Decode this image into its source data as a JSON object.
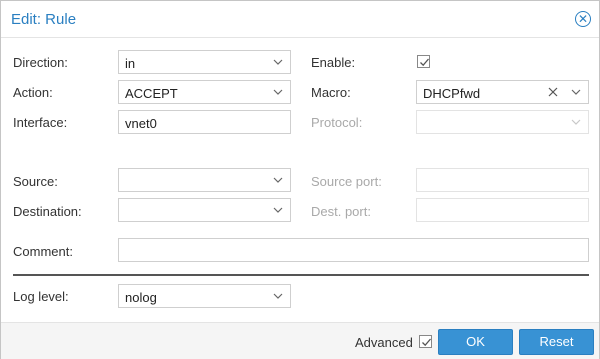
{
  "title": "Edit: Rule",
  "labels": {
    "direction": "Direction:",
    "action": "Action:",
    "interface": "Interface:",
    "enable": "Enable:",
    "macro": "Macro:",
    "protocol": "Protocol:",
    "source": "Source:",
    "destination": "Destination:",
    "source_port": "Source port:",
    "dest_port": "Dest. port:",
    "comment": "Comment:",
    "log_level": "Log level:"
  },
  "values": {
    "direction": "in",
    "action": "ACCEPT",
    "interface": "vnet0",
    "macro": "DHCPfwd",
    "protocol": "",
    "source": "",
    "destination": "",
    "source_port": "",
    "dest_port": "",
    "comment": "",
    "log_level": "nolog"
  },
  "enable_checked": true,
  "footer": {
    "advanced_label": "Advanced",
    "advanced_checked": true,
    "ok_label": "OK",
    "reset_label": "Reset"
  }
}
